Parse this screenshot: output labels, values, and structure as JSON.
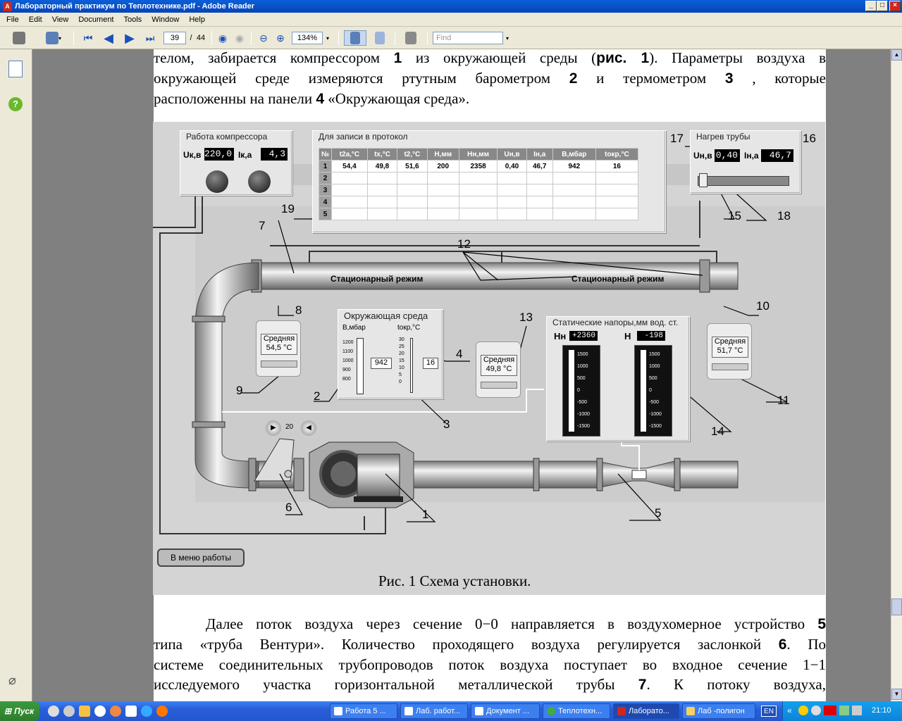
{
  "window": {
    "title": "Лабораторный практикум по Теплотехнике.pdf - Adobe Reader",
    "min": "_",
    "max": "□",
    "close": "×"
  },
  "menu": [
    "File",
    "Edit",
    "View",
    "Document",
    "Tools",
    "Window",
    "Help"
  ],
  "toolbar": {
    "page_current": "39",
    "page_sep": "/",
    "page_total": "44",
    "zoom": "134%",
    "find_placeholder": "Find"
  },
  "para_top": {
    "line1_a": "телом, забирается компрессором ",
    "line1_b": "1",
    "line1_c": " из окружающей среды (",
    "line1_d": "рис. 1",
    "line1_e": "). Параметры воздуха в",
    "line2_a": "окружающей среде измеряются ртутным барометром ",
    "line2_b": "2",
    "line2_c": " и термометром ",
    "line2_d": "3",
    "line2_e": " , которые",
    "line3_a": "расположенны на панели ",
    "line3_b": "4",
    "line3_c": " «Окружающая среда»."
  },
  "figure": {
    "compressor_panel": {
      "title": "Работа компрессора",
      "uk_label": "Uк,в",
      "uk_value": "220,0",
      "ik_label": "Iк,а",
      "ik_value": "4,3"
    },
    "protocol": {
      "title": "Для записи в протокол",
      "headers": [
        "№",
        "t2a,°C",
        "tx,°C",
        "t2,°C",
        "H,мм",
        "Hн,мм",
        "Uн,в",
        "Iн,а",
        "B,мбар",
        "tокр,°C"
      ],
      "rows": [
        [
          "1",
          "54,4",
          "49,8",
          "51,6",
          "200",
          "2358",
          "0,40",
          "46,7",
          "942",
          "16"
        ],
        [
          "2",
          "",
          "",
          "",
          "",
          "",
          "",
          "",
          "",
          ""
        ],
        [
          "3",
          "",
          "",
          "",
          "",
          "",
          "",
          "",
          "",
          ""
        ],
        [
          "4",
          "",
          "",
          "",
          "",
          "",
          "",
          "",
          "",
          ""
        ],
        [
          "5",
          "",
          "",
          "",
          "",
          "",
          "",
          "",
          "",
          ""
        ]
      ]
    },
    "heating_panel": {
      "title": "Нагрев трубы",
      "un_label": "Uн,в",
      "un_value": "0,40",
      "in_label": "Iн,а",
      "in_value": "46,7"
    },
    "pipe_label_left": "Стационарный режим",
    "pipe_label_right": "Стационарный режим",
    "meter_left": {
      "line1": "Средняя",
      "line2": "54,5 °C"
    },
    "meter_mid": {
      "line1": "Средняя",
      "line2": "49,8 °C"
    },
    "meter_right": {
      "line1": "Средняя",
      "line2": "51,7 °C"
    },
    "env_panel": {
      "title": "Окружающая среда",
      "b_label": "В,мбар",
      "t_label": "tокр,°С",
      "b_value": "942",
      "t_value": "16",
      "b_ticks": [
        "1200",
        "1100",
        "1000",
        "900",
        "800"
      ],
      "t_ticks": [
        "30",
        "25",
        "20",
        "15",
        "10",
        "5",
        "0"
      ]
    },
    "pressure_panel": {
      "title": "Статические напоры,мм вод. ст.",
      "hn_label": "Hн",
      "hn_value": "+2360",
      "h_label": "H",
      "h_value": "-198",
      "ticks": [
        "1500",
        "1000",
        "500",
        "0",
        "-500",
        "-1000",
        "-1500"
      ]
    },
    "flow_value": "20",
    "menu_button": "В меню работы",
    "numbers": [
      "1",
      "2",
      "3",
      "4",
      "5",
      "6",
      "7",
      "8",
      "9",
      "10",
      "11",
      "12",
      "13",
      "14",
      "15",
      "16",
      "17",
      "18",
      "19"
    ],
    "caption": "Рис. 1 Схема установки."
  },
  "para_bottom": {
    "line1_a": "Далее поток воздуха через сечение 0−0 направляется в воздухомерное устройство ",
    "line1_b": "5",
    "line2_a": "типа «труба Вентури». Количество проходящего воздуха регулируется заслонкой ",
    "line2_b": "6",
    "line2_c": ". По",
    "line3": "системе соединительных трубопроводов поток воздуха поступает во входное  сечение 1−1",
    "line4_a": "исследуемого участка горизонтальной металлической трубы ",
    "line4_b": "7",
    "line4_c": ". К потоку воздуха,"
  },
  "taskbar": {
    "start": "Пуск",
    "tasks": [
      "Работа 5 ...",
      "Лаб. работ...",
      "Документ ...",
      "Теплотехн...",
      "Лаборато...",
      "Лаб -полигон"
    ],
    "lang": "EN",
    "clock": "21:10"
  },
  "colors": {
    "titlebar": "#0843b8",
    "chrome": "#ece9d8",
    "taskbar": "#2457cf",
    "start": "#2c7d2c"
  }
}
